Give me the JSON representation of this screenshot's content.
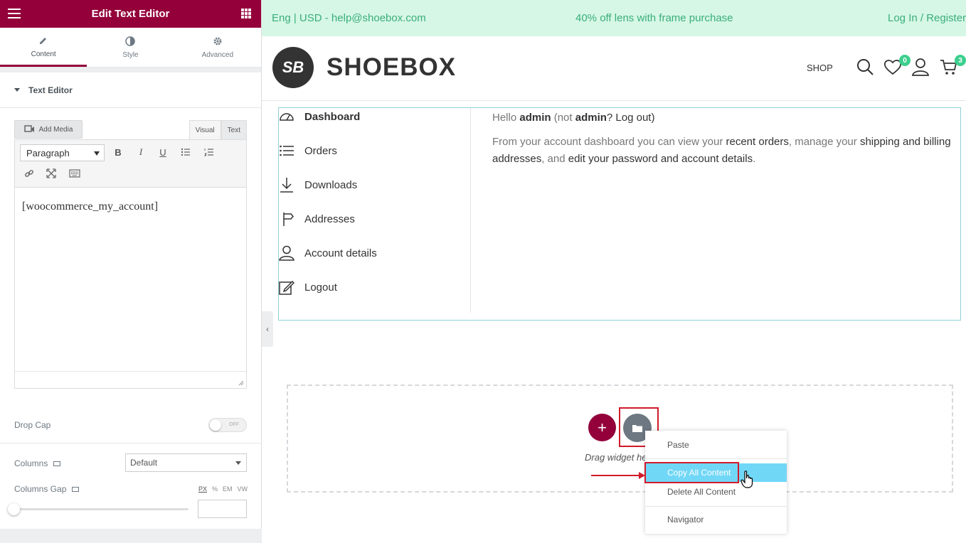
{
  "panel": {
    "title": "Edit Text Editor",
    "tabs": [
      {
        "label": "Content"
      },
      {
        "label": "Style"
      },
      {
        "label": "Advanced"
      }
    ],
    "section": "Text Editor",
    "add_media": "Add Media",
    "view_tabs": {
      "visual": "Visual",
      "text": "Text"
    },
    "format_select": "Paragraph",
    "editor_content": "[woocommerce_my_account]",
    "drop_cap": {
      "label": "Drop Cap",
      "state": "OFF"
    },
    "columns": {
      "label": "Columns",
      "value": "Default"
    },
    "columns_gap": {
      "label": "Columns Gap",
      "units": [
        "PX",
        "%",
        "EM",
        "VW"
      ]
    }
  },
  "topbar": {
    "left": "Eng | USD - help@shoebox.com",
    "center": "40% off lens with frame purchase",
    "right": "Log In / Register"
  },
  "header": {
    "logo_mark": "SB",
    "logo_text": "SHOEBOX",
    "shop": "SHOP",
    "wishlist_count": "0",
    "cart_count": "3"
  },
  "account": {
    "nav": [
      "Dashboard",
      "Orders",
      "Downloads",
      "Addresses",
      "Account details",
      "Logout"
    ],
    "hello_prefix": "Hello ",
    "user": "admin",
    "hello_mid": " (not ",
    "hello_suffix": "? Log out)",
    "desc": {
      "p1": "From your account dashboard you can view your ",
      "l1": "recent orders",
      "p2": ", manage your ",
      "l2": "shipping and billing addresses",
      "p3": ", and ",
      "l3": "edit your password and account details",
      "p4": "."
    }
  },
  "dropzone": {
    "drag_text": "Drag widget here"
  },
  "context_menu": {
    "items": [
      "Paste",
      "Copy All Content",
      "Delete All Content",
      "Navigator"
    ]
  },
  "colors": {
    "brand": "#93003a",
    "topbar_bg": "#d6f7e6",
    "topbar_text": "#3aae7a",
    "badge": "#3ccf8e",
    "hover": "#71d7f7",
    "highlight": "#d11a2a"
  }
}
